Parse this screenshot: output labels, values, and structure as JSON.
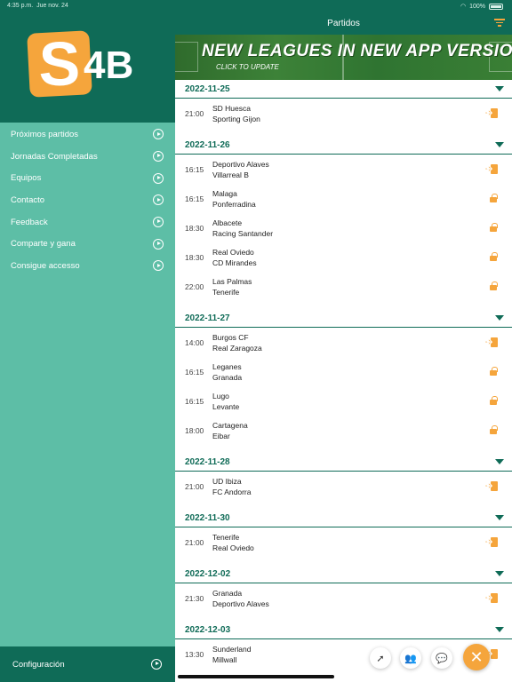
{
  "status": {
    "time": "4:35 p.m.",
    "date": "Jue nov. 24",
    "battery": "100%"
  },
  "logo": {
    "letter": "S",
    "text": "4B"
  },
  "menu": [
    {
      "label": "Próximos partidos"
    },
    {
      "label": "Jornadas Completadas"
    },
    {
      "label": "Equipos"
    },
    {
      "label": "Contacto"
    },
    {
      "label": "Feedback"
    },
    {
      "label": "Comparte y gana"
    },
    {
      "label": "Consigue accesso"
    }
  ],
  "footer": {
    "label": "Configuración"
  },
  "header": {
    "title": "Partidos"
  },
  "banner": {
    "title": "NEW LEAGUES IN NEW APP VERSION",
    "subtitle": "CLICK TO UPDATE"
  },
  "days": [
    {
      "date": "2022-11-25",
      "matches": [
        {
          "time": "21:00",
          "home": "SD Huesca",
          "away": "Sporting Gijon",
          "icon": "enter-icon"
        }
      ]
    },
    {
      "date": "2022-11-26",
      "matches": [
        {
          "time": "16:15",
          "home": "Deportivo Alaves",
          "away": "Villarreal B",
          "icon": "enter-icon"
        },
        {
          "time": "16:15",
          "home": "Malaga",
          "away": "Ponferradina",
          "icon": "lock-icon"
        },
        {
          "time": "18:30",
          "home": "Albacete",
          "away": "Racing Santander",
          "icon": "lock-icon"
        },
        {
          "time": "18:30",
          "home": "Real Oviedo",
          "away": "CD Mirandes",
          "icon": "lock-icon"
        },
        {
          "time": "22:00",
          "home": "Las Palmas",
          "away": "Tenerife",
          "icon": "lock-icon"
        }
      ]
    },
    {
      "date": "2022-11-27",
      "matches": [
        {
          "time": "14:00",
          "home": "Burgos CF",
          "away": "Real Zaragoza",
          "icon": "enter-icon"
        },
        {
          "time": "16:15",
          "home": "Leganes",
          "away": "Granada",
          "icon": "lock-icon"
        },
        {
          "time": "16:15",
          "home": "Lugo",
          "away": "Levante",
          "icon": "lock-icon"
        },
        {
          "time": "18:00",
          "home": "Cartagena",
          "away": "Eibar",
          "icon": "lock-icon"
        }
      ]
    },
    {
      "date": "2022-11-28",
      "matches": [
        {
          "time": "21:00",
          "home": "UD Ibiza",
          "away": "FC Andorra",
          "icon": "enter-icon"
        }
      ]
    },
    {
      "date": "2022-11-30",
      "matches": [
        {
          "time": "21:00",
          "home": "Tenerife",
          "away": "Real Oviedo",
          "icon": "enter-icon"
        }
      ]
    },
    {
      "date": "2022-12-02",
      "matches": [
        {
          "time": "21:30",
          "home": "Granada",
          "away": "Deportivo Alaves",
          "icon": "enter-icon"
        }
      ]
    },
    {
      "date": "2022-12-03",
      "matches": [
        {
          "time": "13:30",
          "home": "Sunderland",
          "away": "Millwall",
          "icon": "enter-icon"
        }
      ]
    }
  ],
  "fabs": {
    "main_icon": "close-icon",
    "small_icons": [
      "rocket-icon",
      "users-icon",
      "chat-icon"
    ]
  },
  "colors": {
    "primary": "#0f6b57",
    "sidebar": "#5dbea6",
    "accent": "#f5a53c"
  }
}
